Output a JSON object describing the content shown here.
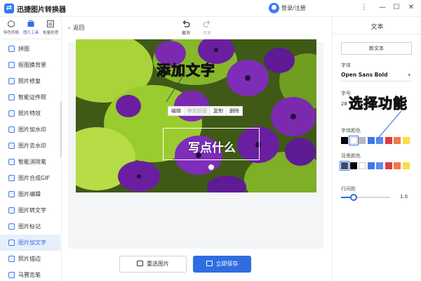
{
  "app": {
    "title": "迅捷图片转换器",
    "login": "登录/注册"
  },
  "window": {
    "minimize": "—",
    "maximize": "☐",
    "close": "✕",
    "menu": "⋮"
  },
  "topnav": [
    {
      "label": "特色转换",
      "icon": "hexagon-icon"
    },
    {
      "label": "图片工具",
      "icon": "toolbox-icon"
    },
    {
      "label": "批量处理",
      "icon": "batch-icon"
    }
  ],
  "sidebar": {
    "items": [
      {
        "label": "拼图"
      },
      {
        "label": "抠图换背景"
      },
      {
        "label": "照片修复"
      },
      {
        "label": "智能证件照"
      },
      {
        "label": "照片特效"
      },
      {
        "label": "图片加水印"
      },
      {
        "label": "图片去水印"
      },
      {
        "label": "智能消除笔"
      },
      {
        "label": "图片合成GIF"
      },
      {
        "label": "图片编辑"
      },
      {
        "label": "图片转文字"
      },
      {
        "label": "图片标记"
      },
      {
        "label": "图片加文字"
      },
      {
        "label": "照片描边"
      },
      {
        "label": "马赛克笔"
      }
    ],
    "active_index": 12
  },
  "main": {
    "back": "返回",
    "undo": "撤消",
    "redo": "恢复",
    "popup": [
      "编辑",
      "移到前面",
      "复制",
      "删除"
    ],
    "text_content": "写点什么",
    "reselect_button": "重选图片",
    "save_button": "立即保存"
  },
  "panel": {
    "title": "文本",
    "new_text": "新文本",
    "font_label": "字体",
    "font_value": "Open Sans Bold",
    "size_label": "字号",
    "size_value": "28",
    "font_color_label": "字体颜色",
    "font_colors": [
      "#000000",
      "#ffffff",
      "#b7b7b7",
      "#3e77e6",
      "#5a8cf0",
      "#e23b3b",
      "#f07a4a",
      "#f6e04a"
    ],
    "bg_color_label": "背景颜色",
    "bg_colors": [
      "#3d4b66",
      "#000000",
      "#ffffff",
      "#3e77e6",
      "#5a8cf0",
      "#e23b3b",
      "#f07a4a",
      "#f6e04a"
    ],
    "line_spacing_label": "行间距",
    "line_spacing_value": "1.0",
    "line_spacing_fraction": 0.25
  },
  "annotations": {
    "add_text": "添加文字",
    "choose_function": "选择功能"
  },
  "colors": {
    "accent": "#2f6de0",
    "annotation": "#ffe000"
  }
}
